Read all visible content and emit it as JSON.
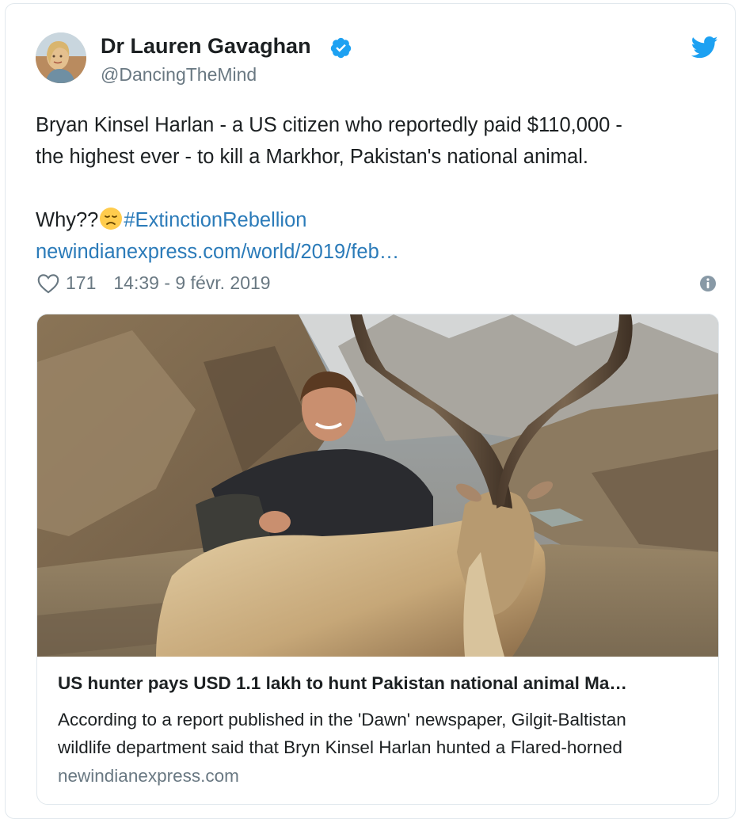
{
  "author": {
    "display_name": "Dr Lauren Gavaghan",
    "handle": "@DancingTheMind",
    "verified": true
  },
  "tweet": {
    "text_line1": "Bryan Kinsel Harlan - a US citizen who reportedly paid $110,000 -",
    "text_line2": "the highest ever - to kill a Markhor, Pakistan's national animal.",
    "why_text": "Why??",
    "emoji": "disappointed-face",
    "hashtag": "#ExtinctionRebellion",
    "link": "newindianexpress.com/world/2019/feb…"
  },
  "meta": {
    "likes": "171",
    "timestamp": "14:39 - 9 févr. 2019"
  },
  "card": {
    "title": "US hunter pays USD 1.1 lakh to hunt Pakistan national animal Ma…",
    "description_line1": "According to a report published in the 'Dawn' newspaper, Gilgit-Baltistan",
    "description_line2": "wildlife department said that Bryn Kinsel Harlan hunted a Flared-horned",
    "domain": "newindianexpress.com"
  },
  "colors": {
    "link": "#2b7bb9",
    "muted": "#697882",
    "verified": "#1da1f2",
    "twitter_brand": "#1da1f2",
    "border": "#e1e8ed"
  },
  "icons": [
    "verified-badge-icon",
    "twitter-bird-icon",
    "disappointed-face-emoji-icon",
    "heart-icon",
    "info-icon"
  ]
}
